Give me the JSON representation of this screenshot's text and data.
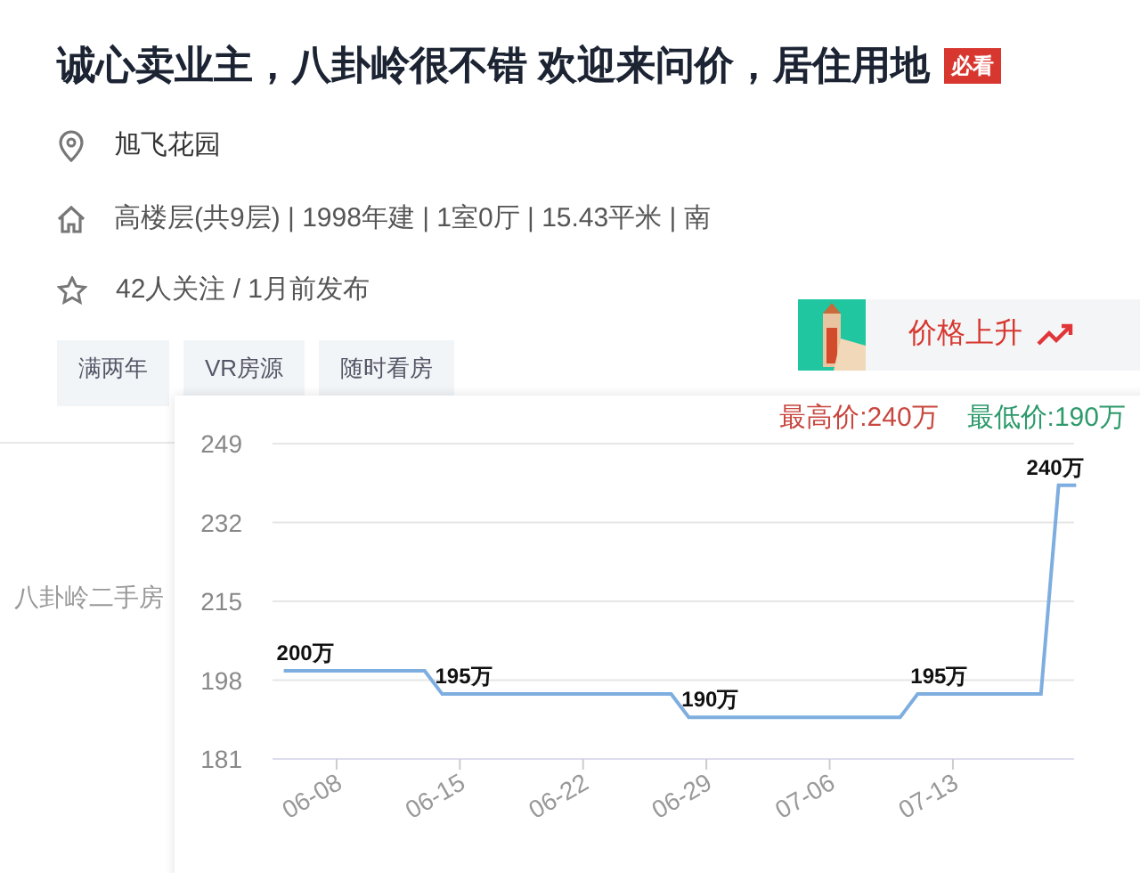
{
  "title": "诚心卖业主，八卦岭很不错 欢迎来问价，居住用地",
  "badge": "必看",
  "location": "旭飞花园",
  "info": "高楼层(共9层) | 1998年建 | 1室0厅 | 15.43平米 | 南",
  "follow": "42人关注 / 1月前发布",
  "tags": [
    "满两年",
    "VR房源",
    "随时看房"
  ],
  "side_link": "八卦岭二手房",
  "trend": {
    "label": "价格上升"
  },
  "price_summary": {
    "max": "最高价:240万",
    "min": "最低价:190万"
  },
  "chart_data": {
    "type": "line",
    "categories": [
      null,
      null,
      null,
      "06-08",
      null,
      null,
      null,
      null,
      null,
      null,
      "06-15",
      null,
      null,
      null,
      null,
      null,
      null,
      "06-22",
      null,
      null,
      null,
      null,
      null,
      null,
      "06-29",
      null,
      null,
      null,
      null,
      null,
      null,
      "07-06",
      null,
      null,
      null,
      null,
      null,
      null,
      "07-13",
      null,
      null,
      null,
      null,
      null,
      null,
      null
    ],
    "series": [
      {
        "color": "#7eaee0",
        "values": [
          200,
          200,
          200,
          200,
          200,
          200,
          200,
          200,
          200,
          195,
          195,
          195,
          195,
          195,
          195,
          195,
          195,
          195,
          195,
          195,
          195,
          195,
          195,
          190,
          190,
          190,
          190,
          190,
          190,
          190,
          190,
          190,
          190,
          190,
          190,
          190,
          195,
          195,
          195,
          195,
          195,
          195,
          195,
          195,
          240,
          240
        ]
      }
    ],
    "value_labels": [
      "200万",
      null,
      null,
      null,
      null,
      null,
      null,
      null,
      null,
      "195万",
      null,
      null,
      null,
      null,
      null,
      null,
      null,
      null,
      null,
      null,
      null,
      null,
      null,
      "190万",
      null,
      null,
      null,
      null,
      null,
      null,
      null,
      null,
      null,
      null,
      null,
      null,
      "195万",
      null,
      null,
      null,
      null,
      null,
      null,
      null,
      "240万",
      null
    ],
    "ylim": [
      181,
      249
    ],
    "grid": true,
    "yticks": [
      181,
      198,
      215,
      232,
      249
    ]
  }
}
